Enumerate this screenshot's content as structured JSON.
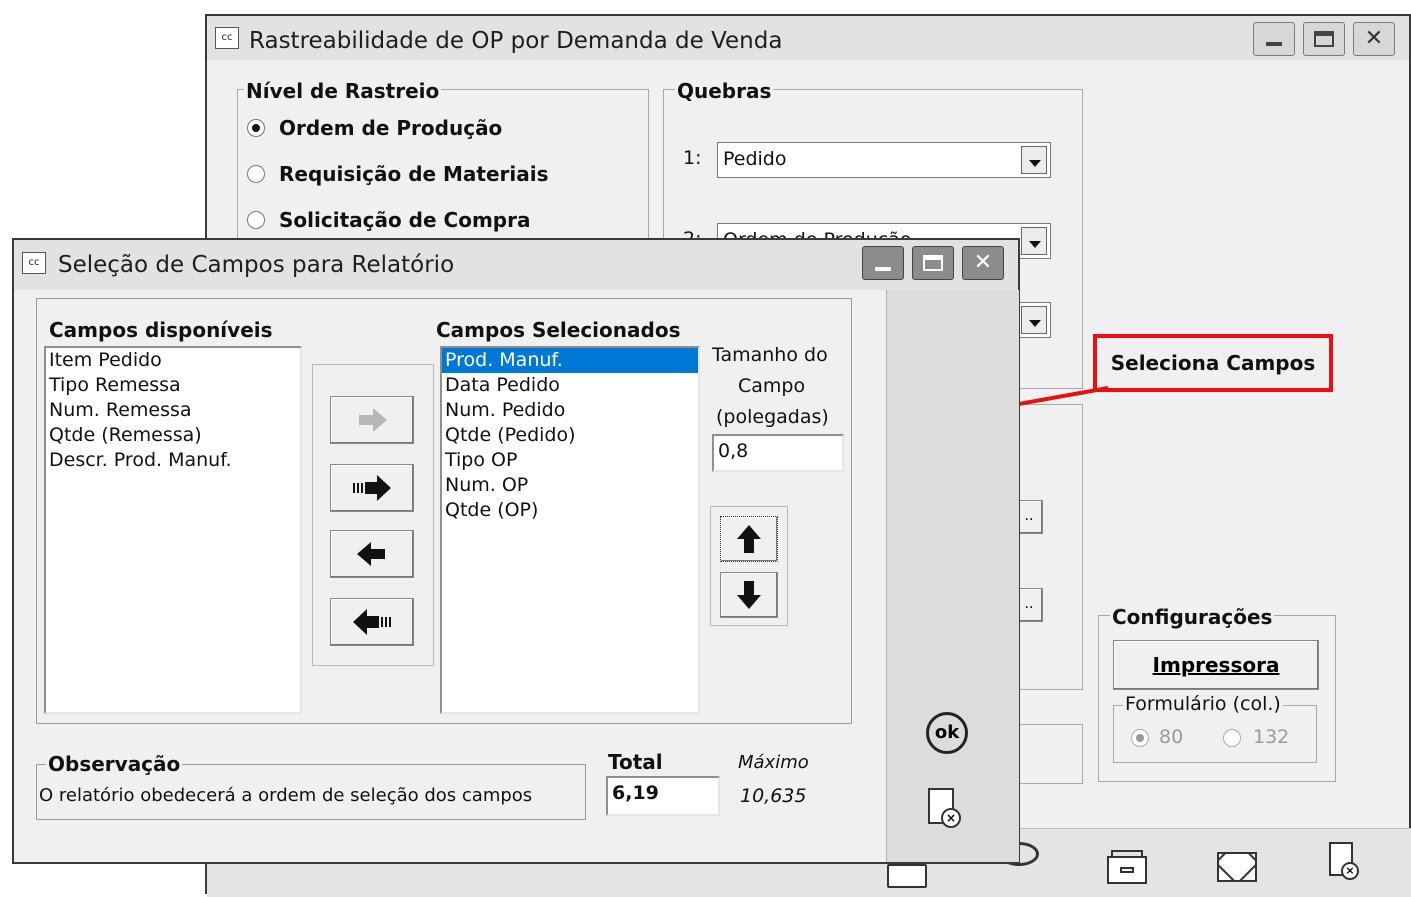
{
  "main_window": {
    "icon_label": "cc",
    "title": "Rastreabilidade de OP por Demanda de Venda",
    "nivel": {
      "label": "Nível de Rastreio",
      "options": [
        "Ordem de Produção",
        "Requisição de Materiais",
        "Solicitação de Compra"
      ],
      "selected_index": 0
    },
    "quebras": {
      "label": "Quebras",
      "row1_label": "1:",
      "row1_value": "Pedido",
      "row2_label": "2:",
      "row2_value": "Ordem de Produção"
    },
    "seleciona_button": "Seleciona Campos",
    "configuracoes": {
      "label": "Configurações",
      "impressora_button": "Impressora",
      "formulario_label": "Formulário (col.)",
      "option_80": "80",
      "option_132": "132",
      "selected": "80"
    }
  },
  "dialog": {
    "icon_label": "cc",
    "title": "Seleção de Campos para Relatório",
    "available_label": "Campos disponíveis",
    "available_items": [
      "Item Pedido",
      "Tipo Remessa",
      "Num. Remessa",
      "Qtde (Remessa)",
      "Descr. Prod. Manuf."
    ],
    "selected_label": "Campos Selecionados",
    "selected_items": [
      "Prod. Manuf.",
      "Data Pedido",
      "Num. Pedido",
      "Qtde (Pedido)",
      "Tipo OP",
      "Num. OP",
      "Qtde (OP)"
    ],
    "selected_highlight_index": 0,
    "tamanho_label_1": "Tamanho do",
    "tamanho_label_2": "Campo",
    "tamanho_label_3": "(polegadas)",
    "tamanho_value": "0,8",
    "observacao_label": "Observação",
    "observacao_text": "O relatório obedecerá a ordem de seleção dos campos",
    "total_label": "Total",
    "total_value": "6,19",
    "maximo_label": "Máximo",
    "maximo_value": "10,635",
    "ok_label": "ok"
  },
  "colors": {
    "annotation_red": "#e81010",
    "selection_blue": "#0078d7",
    "window_bg": "#f0f0f0"
  }
}
